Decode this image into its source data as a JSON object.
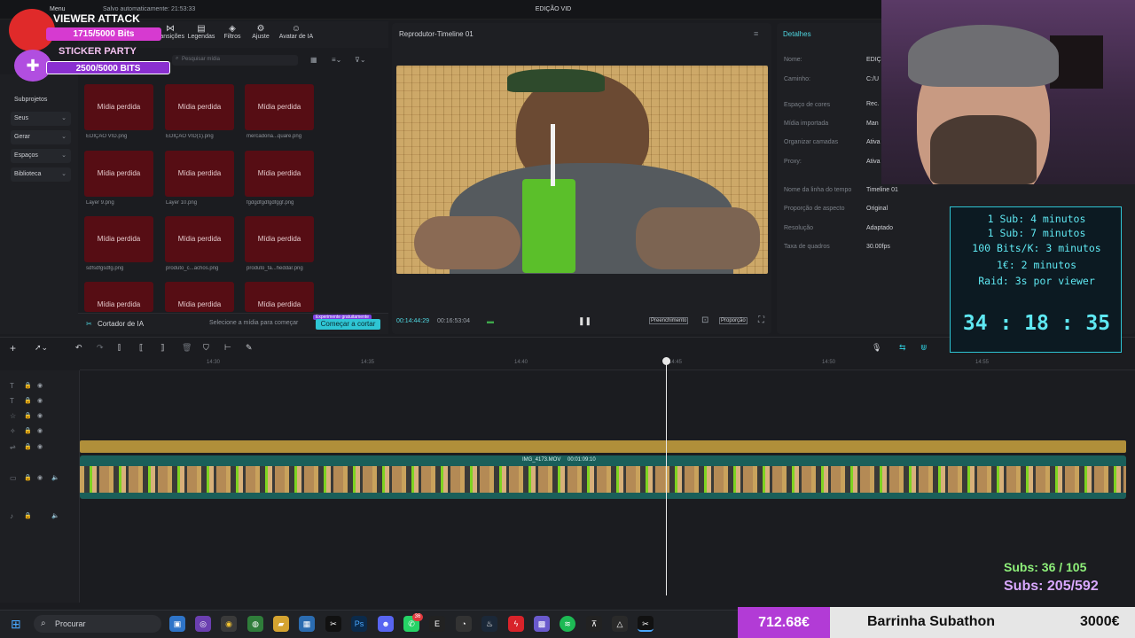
{
  "app": {
    "title": "EDIÇÃO VID",
    "autosave": "Salvo automaticamente: 21:53:33",
    "menu_label": "Menu"
  },
  "toolbar": {
    "tools": [
      {
        "label": "transições",
        "icon": "transitions-icon"
      },
      {
        "label": "Legendas",
        "icon": "captions-icon"
      },
      {
        "label": "Filtros",
        "icon": "filters-icon"
      },
      {
        "label": "Ajuste",
        "icon": "adjust-icon"
      },
      {
        "label": "Avatar de IA",
        "icon": "avatar-icon"
      }
    ]
  },
  "media": {
    "search_placeholder": "Pesquisar mídia",
    "subprojects": "Subprojetos",
    "nav": [
      "Seus",
      "Gerar",
      "Espaços",
      "Biblioteca"
    ],
    "missing_label": "Mídia perdida",
    "items": [
      "EDIÇÃO VID.png",
      "EDIÇÃO VID(1).png",
      "mercadona...quare.png",
      "Layer 9.png",
      "Layer 10.png",
      "fgdgdfgdfgdfggf.png",
      "sdfsdfgsdfg.png",
      "produto_c...achos.png",
      "produto_fa...heddar.png"
    ],
    "ai_cutter": "Cortador de IA",
    "ai_hint": "Selecione a mídia para começar",
    "ai_badge": "Experimente gratuitamente",
    "ai_button": "Começar a cortar"
  },
  "player": {
    "title": "Reprodutor-Timeline 01",
    "current": "00:14:44:29",
    "total": "00:16:53:04",
    "fill": "Preenchimento",
    "ratio": "Proporção"
  },
  "details": {
    "title": "Detalhes",
    "rows": [
      {
        "label": "Nome:",
        "value": "EDIÇ"
      },
      {
        "label": "Caminho:",
        "value": "C:/U"
      },
      {
        "label": "Espaço de cores",
        "value": "Rec."
      },
      {
        "label": "Mídia importada",
        "value": "Man"
      },
      {
        "label": "Organizar camadas",
        "value": "Ativa"
      },
      {
        "label": "Proxy:",
        "value": "Ativa"
      },
      {
        "label": "Nome da linha do tempo",
        "value": "Timeline 01"
      },
      {
        "label": "Proporção de aspecto",
        "value": "Original"
      },
      {
        "label": "Resolução",
        "value": "Adaptado"
      },
      {
        "label": "Taxa de quadros",
        "value": "30.00fps"
      }
    ]
  },
  "timeline": {
    "ruler": [
      "14:30",
      "14:35",
      "14:40",
      "14:45",
      "14:50",
      "14:55"
    ],
    "clip_name": "IMG_4173.MOV",
    "clip_duration": "00:01:09:10"
  },
  "stream": {
    "viewer_attack": "VIEWER ATTACK",
    "bits1": "1715/5000 Bits",
    "sticker_party": "STICKER PARTY",
    "bits2": "2500/5000 BITS",
    "rules": [
      "1 Sub: 4 minutos",
      "1 Sub: 7 minutos",
      "100 Bits/K: 3 minutos",
      "1€: 2 minutos",
      "Raid: 3s por viewer"
    ],
    "timer": "34 : 18 : 35",
    "subs1": "Subs: 36 / 105",
    "subs2": "Subs: 205/592",
    "bar_amount": "712.68€",
    "bar_title": "Barrinha Subathon",
    "bar_goal": "3000€"
  },
  "taskbar": {
    "search": "Procurar",
    "badge": "36"
  },
  "colors": {
    "missing": "#560d14",
    "accent": "#2ec5d4",
    "track": "#1a5f5a"
  }
}
